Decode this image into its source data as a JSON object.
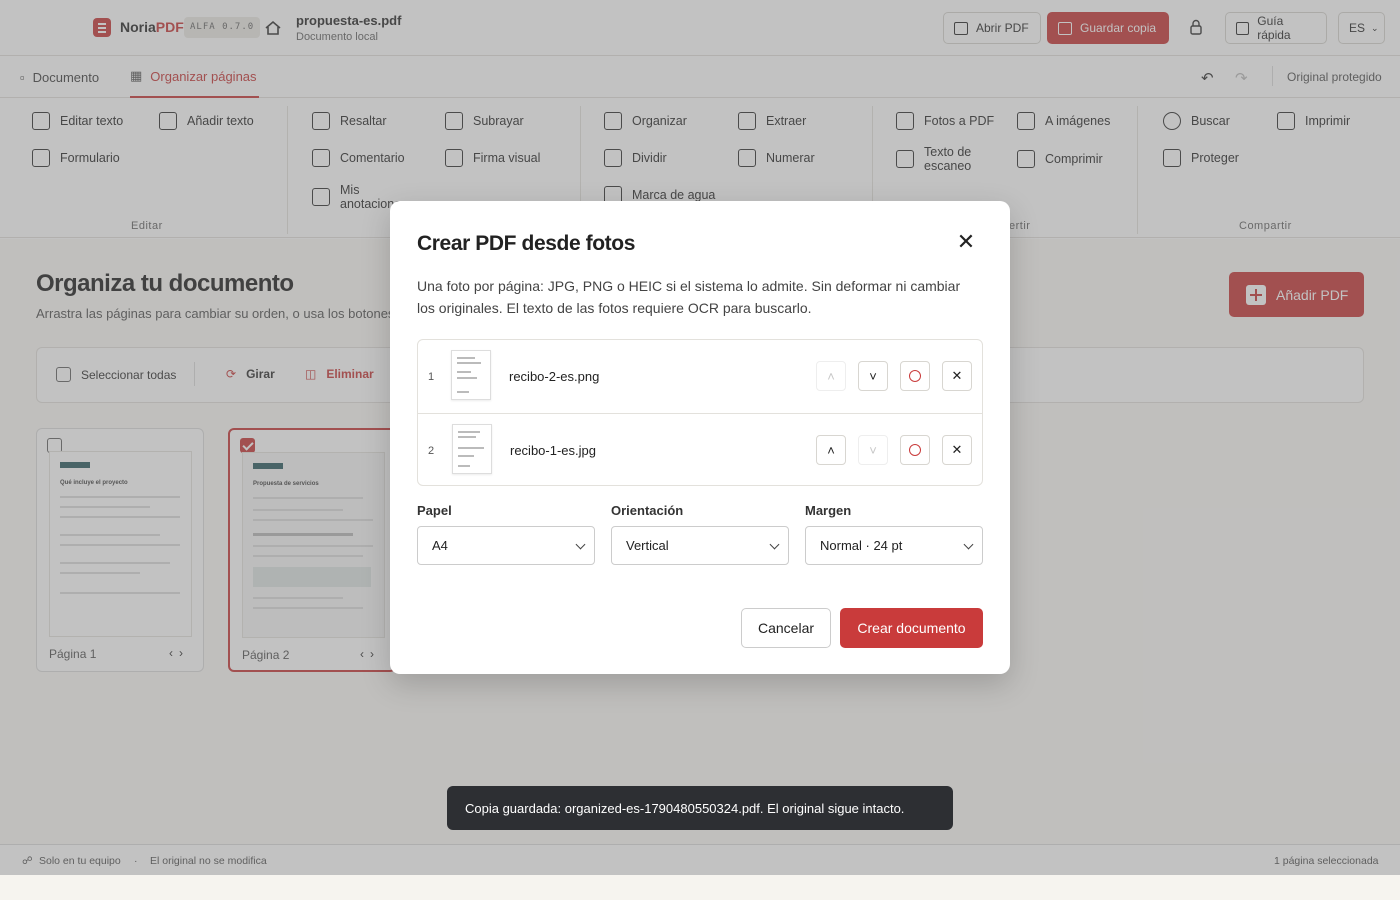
{
  "header": {
    "brand_main": "Noria",
    "brand_accent": "PDF",
    "version": "ALFA 0.7.0",
    "file_name": "propuesta-es.pdf",
    "file_location": "Documento local",
    "open_label": "Abrir PDF",
    "save_label": "Guardar copia",
    "guide_label": "Guía rápida",
    "lang": "ES"
  },
  "tabs": {
    "document": "Documento",
    "organize": "Organizar páginas",
    "protected": "Original protegido"
  },
  "ribbon": {
    "edit_text": "Editar texto",
    "add_text": "Añadir texto",
    "form": "Formulario",
    "highlight": "Resaltar",
    "underline": "Subrayar",
    "comment": "Comentario",
    "visual_sign": "Firma visual",
    "my_notes": "Mis anotaciones",
    "organize": "Organizar",
    "extract": "Extraer",
    "split": "Dividir",
    "number": "Numerar",
    "watermark": "Marca de agua",
    "photos_pdf": "Fotos a PDF",
    "to_images": "A imágenes",
    "scan_text": "Texto de escaneo",
    "compress": "Comprimir",
    "search": "Buscar",
    "print": "Imprimir",
    "protect": "Proteger",
    "group_edit": "Editar",
    "group_convert": "ertir",
    "group_share": "Compartir"
  },
  "main": {
    "title": "Organiza tu documento",
    "subtitle": "Arrastra las páginas para cambiar su orden, o usa los botones de",
    "add_pdf": "Añadir PDF",
    "select_all": "Seleccionar todas",
    "rotate": "Girar",
    "delete": "Eliminar",
    "pages": [
      {
        "label": "Página 1",
        "heading": "Qué incluye el proyecto",
        "selected": false
      },
      {
        "label": "Página 2",
        "heading": "Propuesta de servicios",
        "selected": true
      }
    ]
  },
  "modal": {
    "title": "Crear PDF desde fotos",
    "description": "Una foto por página: JPG, PNG o HEIC si el sistema lo admite. Sin deformar ni cambiar los originales. El texto de las fotos requiere OCR para buscarlo.",
    "photos": [
      {
        "index": "1",
        "name": "recibo-2-es.png"
      },
      {
        "index": "2",
        "name": "recibo-1-es.jpg"
      }
    ],
    "paper_label": "Papel",
    "paper_value": "A4",
    "orientation_label": "Orientación",
    "orientation_value": "Vertical",
    "margin_label": "Margen",
    "margin_value": "Normal · 24 pt",
    "cancel": "Cancelar",
    "create": "Crear documento"
  },
  "toast": "Copia guardada: organized-es-1790480550324.pdf. El original sigue intacto.",
  "footer": {
    "local": "Solo en tu equipo",
    "unchanged": "El original no se modifica",
    "selection": "1 página seleccionada"
  },
  "colors": {
    "accent": "#c93b3b",
    "toast_bg": "#2d2f33"
  }
}
